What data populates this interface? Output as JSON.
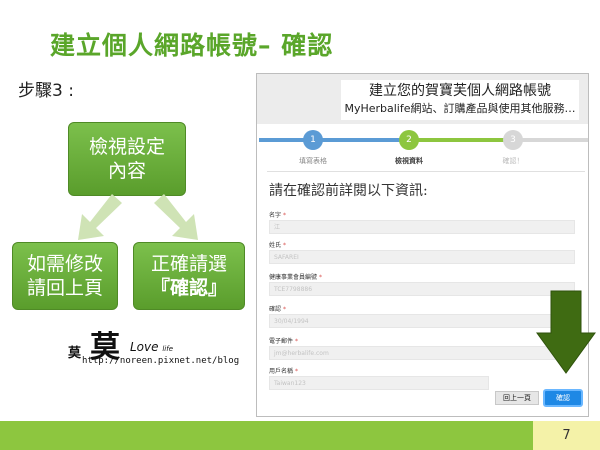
{
  "slide": {
    "title": "建立個人網路帳號– 確認",
    "step": "步驟3 :",
    "page_number": "7"
  },
  "flow": {
    "top": "檢視設定內容",
    "left": "如需修改請回上頁",
    "right_line1": "正確請選",
    "right_line2": "『確認』"
  },
  "logo": {
    "char_small": "莫",
    "char_big": "莫",
    "love": "Love",
    "life": "life",
    "url": "http://noreen.pixnet.net/blog"
  },
  "screenshot": {
    "heading": "建立您的賀寶芙個人網路帳號",
    "subheading": "MyHerbalife網站、訂購產品與使用其他服務…",
    "steps": [
      {
        "num": "1",
        "label": "填寫表格"
      },
      {
        "num": "2",
        "label": "檢視資料"
      },
      {
        "num": "3",
        "label": "確認！"
      }
    ],
    "confirm_title": "請在確認前詳閱以下資訊:",
    "fields": [
      {
        "label": "名字",
        "value": "江"
      },
      {
        "label": "姓氏",
        "value": "SAFAREI"
      },
      {
        "label": "健康事業會員編號",
        "value": "TCE7798886"
      },
      {
        "label": "確認",
        "value": "30/04/1994"
      },
      {
        "label": "電子郵件",
        "value": "jm@herbalife.com"
      },
      {
        "label": "用戶名稱",
        "value": "Taiwan123"
      }
    ],
    "required_mark": "*",
    "back_button": "回上一頁",
    "confirm_button": "確認"
  },
  "colors": {
    "accent_green": "#5aa62a",
    "footer_green": "#8dc63f",
    "arrow_green": "#3f6b12",
    "button_blue": "#1e88e5"
  }
}
